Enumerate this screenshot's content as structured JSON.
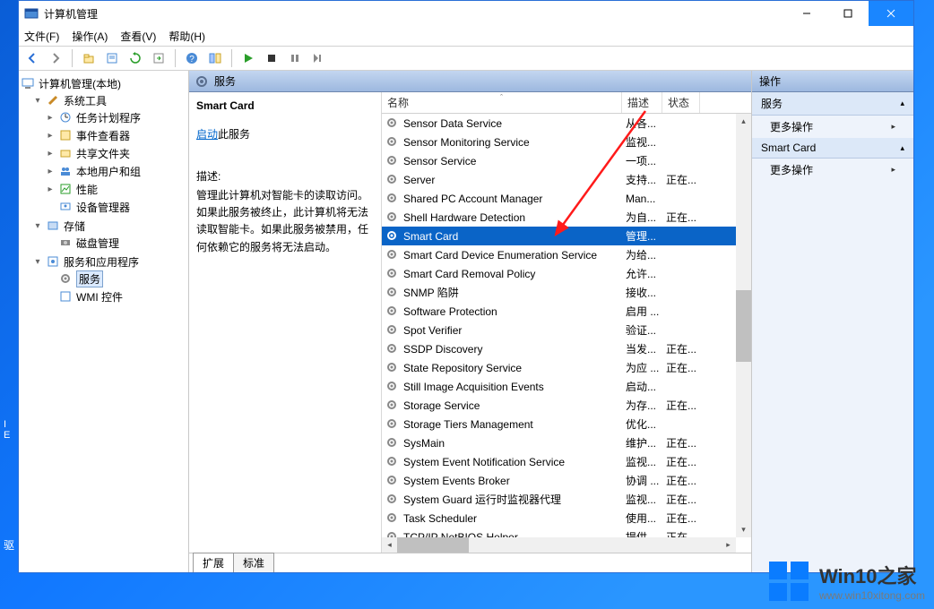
{
  "window": {
    "title": "计算机管理"
  },
  "menu": [
    "文件(F)",
    "操作(A)",
    "查看(V)",
    "帮助(H)"
  ],
  "tree": {
    "root": "计算机管理(本地)",
    "sys": "系统工具",
    "sys_items": [
      "任务计划程序",
      "事件查看器",
      "共享文件夹",
      "本地用户和组",
      "性能",
      "设备管理器"
    ],
    "storage": "存储",
    "storage_items": [
      "磁盘管理"
    ],
    "svcapp": "服务和应用程序",
    "svc": "服务",
    "wmi": "WMI 控件"
  },
  "mid": {
    "header": "服务",
    "selected": "Smart Card",
    "start_link": "启动",
    "start_suffix": "此服务",
    "desc_label": "描述:",
    "desc": "管理此计算机对智能卡的读取访问。如果此服务被终止，此计算机将无法读取智能卡。如果此服务被禁用，任何依赖它的服务将无法启动。"
  },
  "cols": {
    "name": "名称",
    "desc": "描述",
    "status": "状态"
  },
  "services": [
    {
      "n": "Sensor Data Service",
      "d": "从各...",
      "s": ""
    },
    {
      "n": "Sensor Monitoring Service",
      "d": "监视...",
      "s": ""
    },
    {
      "n": "Sensor Service",
      "d": "一项...",
      "s": ""
    },
    {
      "n": "Server",
      "d": "支持...",
      "s": "正在..."
    },
    {
      "n": "Shared PC Account Manager",
      "d": "Man...",
      "s": ""
    },
    {
      "n": "Shell Hardware Detection",
      "d": "为自...",
      "s": "正在..."
    },
    {
      "n": "Smart Card",
      "d": "管理...",
      "s": "",
      "sel": true
    },
    {
      "n": "Smart Card Device Enumeration Service",
      "d": "为给...",
      "s": ""
    },
    {
      "n": "Smart Card Removal Policy",
      "d": "允许...",
      "s": ""
    },
    {
      "n": "SNMP 陷阱",
      "d": "接收...",
      "s": ""
    },
    {
      "n": "Software Protection",
      "d": "启用 ...",
      "s": ""
    },
    {
      "n": "Spot Verifier",
      "d": "验证...",
      "s": ""
    },
    {
      "n": "SSDP Discovery",
      "d": "当发...",
      "s": "正在..."
    },
    {
      "n": "State Repository Service",
      "d": "为应 ...",
      "s": "正在..."
    },
    {
      "n": "Still Image Acquisition Events",
      "d": "启动...",
      "s": ""
    },
    {
      "n": "Storage Service",
      "d": "为存...",
      "s": "正在..."
    },
    {
      "n": "Storage Tiers Management",
      "d": "优化...",
      "s": ""
    },
    {
      "n": "SysMain",
      "d": "维护...",
      "s": "正在..."
    },
    {
      "n": "System Event Notification Service",
      "d": "监视...",
      "s": "正在..."
    },
    {
      "n": "System Events Broker",
      "d": "协调 ...",
      "s": "正在..."
    },
    {
      "n": "System Guard 运行时监视器代理",
      "d": "监视...",
      "s": "正在..."
    },
    {
      "n": "Task Scheduler",
      "d": "使用...",
      "s": "正在..."
    },
    {
      "n": "TCP/IP NetBIOS Helper",
      "d": "提供...",
      "s": "正在..."
    }
  ],
  "tabs": {
    "ext": "扩展",
    "std": "标准"
  },
  "actions": {
    "title": "操作",
    "sec1": "服务",
    "more": "更多操作",
    "sec2": "Smart Card"
  },
  "watermark": {
    "t1": "Win10之家",
    "t2": "www.win10xitong.com"
  },
  "desk": {
    "l1": "I",
    "l2": "E",
    "drv": "驱"
  }
}
